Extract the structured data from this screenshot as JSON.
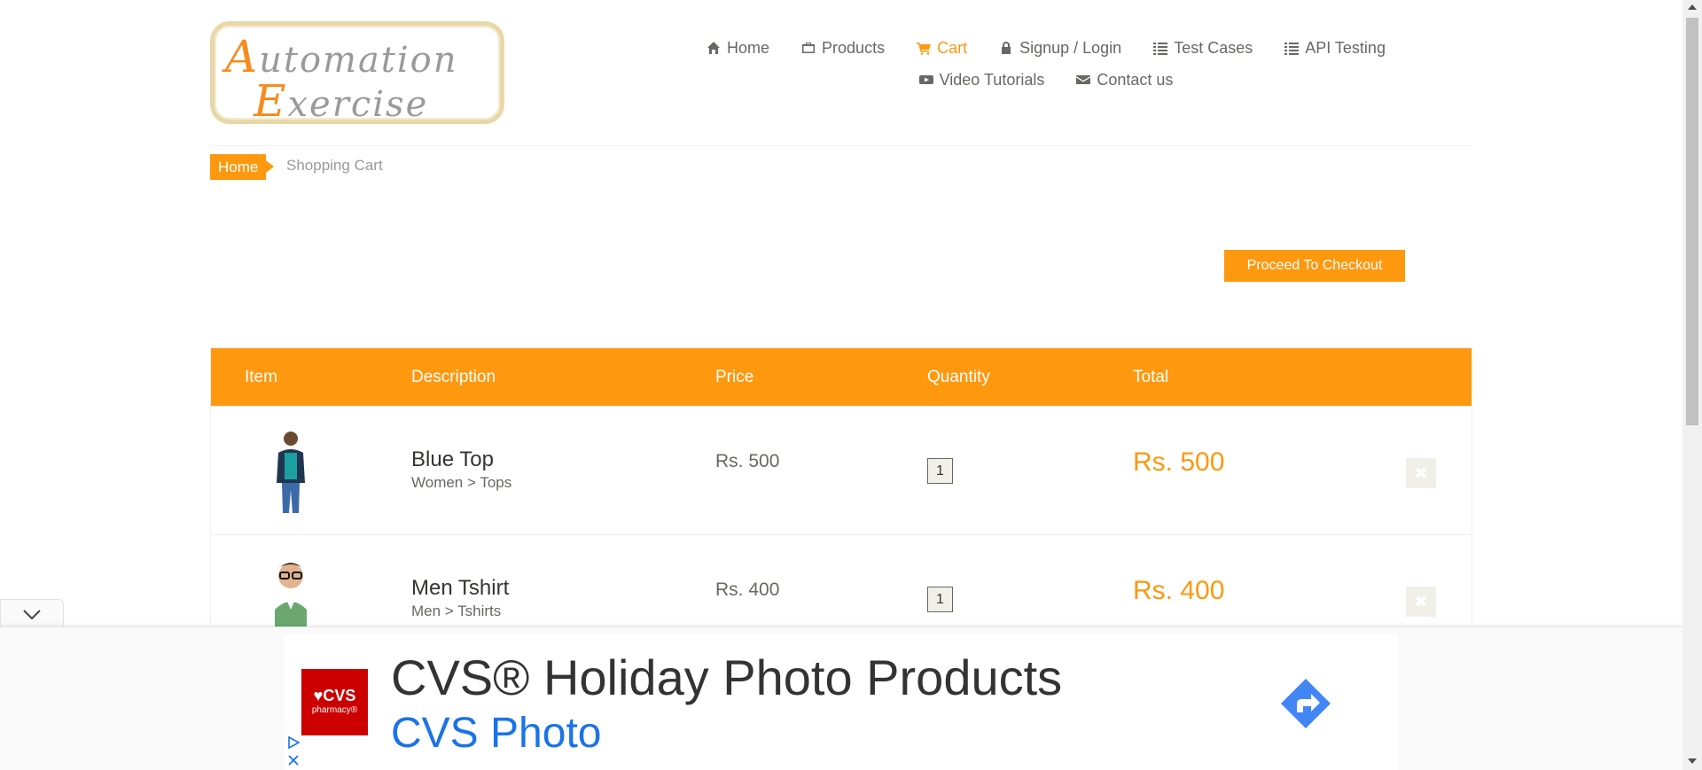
{
  "logo": {
    "line1_cap": "A",
    "line1_rest": "utomation",
    "line2_cap": "E",
    "line2_rest": "xercise"
  },
  "nav": {
    "row1": [
      {
        "label": "Home",
        "icon": "home-icon"
      },
      {
        "label": "Products",
        "icon": "products-icon"
      },
      {
        "label": "Cart",
        "icon": "cart-icon",
        "active": true
      },
      {
        "label": "Signup / Login",
        "icon": "lock-icon"
      },
      {
        "label": "Test Cases",
        "icon": "list-icon"
      },
      {
        "label": "API Testing",
        "icon": "list-icon"
      }
    ],
    "row2": [
      {
        "label": "Video Tutorials",
        "icon": "youtube-icon"
      },
      {
        "label": "Contact us",
        "icon": "envelope-icon"
      }
    ]
  },
  "breadcrumb": {
    "home": "Home",
    "current": "Shopping Cart"
  },
  "checkout_button": "Proceed To Checkout",
  "table": {
    "headers": [
      "Item",
      "Description",
      "Price",
      "Quantity",
      "Total"
    ],
    "rows": [
      {
        "name": "Blue Top",
        "category": "Women > Tops",
        "price": "Rs. 500",
        "quantity": "1",
        "total": "Rs. 500",
        "delete": "✖"
      },
      {
        "name": "Men Tshirt",
        "category": "Men > Tshirts",
        "price": "Rs. 400",
        "quantity": "1",
        "total": "Rs. 400",
        "delete": "✖"
      }
    ]
  },
  "ad": {
    "logo_line1": "♥CVS",
    "logo_line2": "pharmacy®",
    "title": "CVS® Holiday Photo Products",
    "subtitle": "CVS Photo"
  },
  "colors": {
    "accent": "#fe980f",
    "text": "#696763",
    "ad_link": "#1a73e8",
    "cvs_red": "#cc0000"
  }
}
